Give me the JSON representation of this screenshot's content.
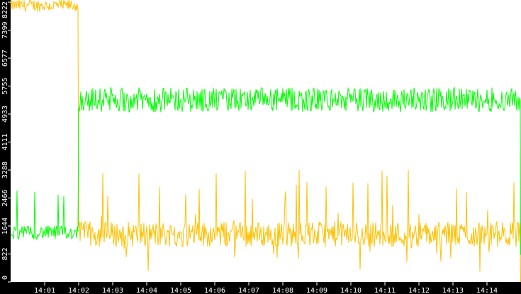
{
  "chart_data": {
    "type": "line",
    "title": "",
    "xlabel": "",
    "ylabel": "",
    "x_range": [
      "14:00",
      "14:15"
    ],
    "ylim": [
      0,
      8222
    ],
    "grid": false,
    "legend": "none",
    "y_ticks": [
      "0",
      "822",
      "1644",
      "2466",
      "3288",
      "4111",
      "4933",
      "5755",
      "6577",
      "7399",
      "8222"
    ],
    "x_ticks": [
      "14:01",
      "14:02",
      "14:03",
      "14:04",
      "14:05",
      "14:06",
      "14:07",
      "14:08",
      "14:09",
      "14:10",
      "14:11",
      "14:12",
      "14:13",
      "14:14"
    ],
    "samples_per_minute": 48,
    "series": [
      {
        "name": "yellow",
        "color": "#FFC000",
        "segments": [
          {
            "from": "14:00",
            "to": "14:02",
            "mean": 8120,
            "noise": 180,
            "spike_prob": 0.0,
            "spike_max": 8300
          },
          {
            "from": "14:02",
            "to": "14:15",
            "mean": 1400,
            "noise": 380,
            "spike_prob": 0.06,
            "spike_max": 3400
          }
        ],
        "end_value": 0
      },
      {
        "name": "green",
        "color": "#00FF00",
        "segments": [
          {
            "from": "14:00",
            "to": "14:02",
            "mean": 1450,
            "noise": 200,
            "spike_prob": 0.05,
            "spike_max": 2700
          },
          {
            "from": "14:02",
            "to": "14:15",
            "mean": 5350,
            "noise": 360,
            "spike_prob": 0.0,
            "spike_max": 5900
          }
        ],
        "end_value": 800
      }
    ]
  }
}
